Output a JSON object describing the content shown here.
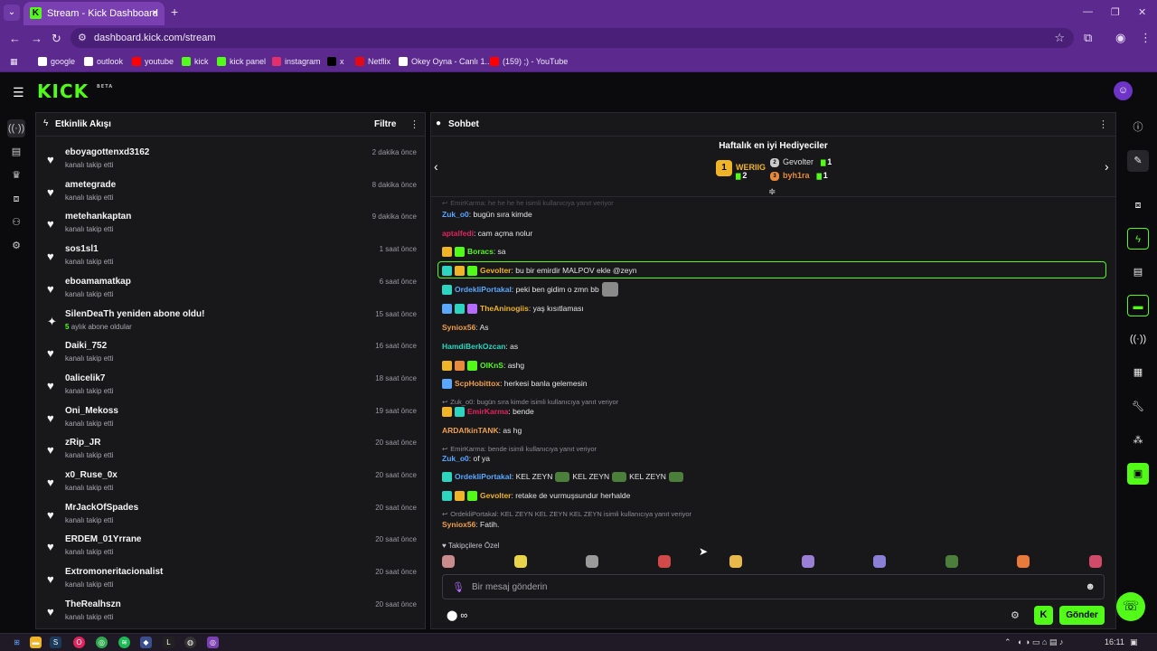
{
  "browser": {
    "tab_title": "Stream - Kick Dashboard",
    "url": "dashboard.kick.com/stream",
    "bookmarks": [
      {
        "label": "google",
        "icon": "google-icon",
        "color": "#ffffff"
      },
      {
        "label": "outlook",
        "icon": "outlook-icon",
        "color": "#ffffff"
      },
      {
        "label": "youtube",
        "icon": "youtube-icon",
        "color": "#ff0000"
      },
      {
        "label": "kick",
        "icon": "kick-icon",
        "color": "#53fc18"
      },
      {
        "label": "kick panel",
        "icon": "kick-icon",
        "color": "#53fc18"
      },
      {
        "label": "instagram",
        "icon": "instagram-icon",
        "color": "#e1306c"
      },
      {
        "label": "x",
        "icon": "x-icon",
        "color": "#000000"
      },
      {
        "label": "Netflix",
        "icon": "netflix-icon",
        "color": "#e50914"
      },
      {
        "label": "Okey Oyna - Canlı 1...",
        "icon": "okey-icon",
        "color": "#ffffff"
      },
      {
        "label": "(159) ;) - YouTube",
        "icon": "youtube-icon",
        "color": "#ff0000"
      }
    ]
  },
  "colors": {
    "accent": "#53fc18",
    "browser_frame": "#5c2a8f",
    "panel": "#18181b"
  },
  "activity": {
    "title": "Etkinlik Akışı",
    "filter_label": "Filtre",
    "items": [
      {
        "name": "eboyagottenxd3162",
        "sub": "kanalı takip etti",
        "time": "2 dakika önce",
        "icon": "heart-icon"
      },
      {
        "name": "ametegrade",
        "sub": "kanalı takip etti",
        "time": "8 dakika önce",
        "icon": "heart-icon"
      },
      {
        "name": "metehankaptan",
        "sub": "kanalı takip etti",
        "time": "9 dakika önce",
        "icon": "heart-icon"
      },
      {
        "name": "sos1sl1",
        "sub": "kanalı takip etti",
        "time": "1 saat önce",
        "icon": "heart-icon"
      },
      {
        "name": "eboamamatkap",
        "sub": "kanalı takip etti",
        "time": "6 saat önce",
        "icon": "heart-icon"
      },
      {
        "name": "SilenDeaTh yeniden abone oldu!",
        "sub_strong": "5",
        "sub": "aylık abone oldular",
        "time": "15 saat önce",
        "icon": "sparkle-icon"
      },
      {
        "name": "Daiki_752",
        "sub": "kanalı takip etti",
        "time": "16 saat önce",
        "icon": "heart-icon"
      },
      {
        "name": "0alicelik7",
        "sub": "kanalı takip etti",
        "time": "18 saat önce",
        "icon": "heart-icon"
      },
      {
        "name": "Oni_Mekoss",
        "sub": "kanalı takip etti",
        "time": "19 saat önce",
        "icon": "heart-icon"
      },
      {
        "name": "zRip_JR",
        "sub": "kanalı takip etti",
        "time": "20 saat önce",
        "icon": "heart-icon"
      },
      {
        "name": "x0_Ruse_0x",
        "sub": "kanalı takip etti",
        "time": "20 saat önce",
        "icon": "heart-icon"
      },
      {
        "name": "MrJackOfSpades",
        "sub": "kanalı takip etti",
        "time": "20 saat önce",
        "icon": "heart-icon"
      },
      {
        "name": "ERDEM_01Yrrane",
        "sub": "kanalı takip etti",
        "time": "20 saat önce",
        "icon": "heart-icon"
      },
      {
        "name": "Extromoneritacionalist",
        "sub": "kanalı takip etti",
        "time": "20 saat önce",
        "icon": "heart-icon"
      },
      {
        "name": "TheRealhszn",
        "sub": "kanalı takip etti",
        "time": "20 saat önce",
        "icon": "heart-icon"
      }
    ]
  },
  "chat": {
    "title": "Sohbet",
    "gifters_title": "Haftalık en iyi Hediyeciler",
    "gifters": [
      {
        "rank": "1",
        "name": "WERIIG",
        "count": "2",
        "color": "#f0b429"
      },
      {
        "rank": "2",
        "name": "Gevolter",
        "count": "1",
        "color": "#c9c9c9"
      },
      {
        "rank": "3",
        "name": "byh1ra",
        "count": "1",
        "color": "#e88a3c"
      }
    ],
    "messages": [
      {
        "type": "reply",
        "text": "EmirKarma: he he he he isimli kullanıcıya yanıt veriyor"
      },
      {
        "user": "Zuk_o0",
        "color": "#5ba7ff",
        "text": ": bugün sıra kimde",
        "badges": []
      },
      {
        "user": "aptalfedi",
        "color": "#e0245e",
        "text": ": cam açma nolur",
        "badges": []
      },
      {
        "user": "Boracs",
        "color": "#53fc18",
        "text": ": sa",
        "badges": [
          "#f0b429",
          "#53fc18"
        ]
      },
      {
        "user": "Gevolter",
        "color": "#f0b429",
        "text": ": bu bir emirdir MALPOV ekle @zeyn",
        "badges": [
          "#2dd4bf",
          "#f0b429",
          "#53fc18"
        ],
        "highlight": true
      },
      {
        "user": "OrdekliPortakal",
        "color": "#5ba7ff",
        "text": ": peki ben gidim o zmn bb",
        "badges": [
          "#2dd4bf"
        ],
        "emote": true
      },
      {
        "user": "TheAninogiis",
        "color": "#f0b429",
        "text": ": yaş kısıtlaması",
        "badges": [
          "#5ba7ff",
          "#2dd4bf",
          "#b46cff"
        ]
      },
      {
        "user": "Syniox56",
        "color": "#f0a04b",
        "text": ": As",
        "badges": []
      },
      {
        "user": "HamdiBerkOzcan",
        "color": "#2dd4bf",
        "text": ": as",
        "badges": []
      },
      {
        "user": "OIKnS",
        "color": "#53fc18",
        "text": ": ashg",
        "badges": [
          "#f0b429",
          "#e88a3c",
          "#53fc18"
        ]
      },
      {
        "user": "ScpHobittox",
        "color": "#f0a04b",
        "text": ": herkesi banla gelemesin",
        "badges": [
          "#5ba7ff"
        ]
      },
      {
        "type": "reply",
        "text": "Zuk_o0: bugün sıra kimde isimli kullanıcıya yanıt veriyor"
      },
      {
        "user": "EmirKarma",
        "color": "#e0245e",
        "text": ": bende",
        "badges": [
          "#f0b429",
          "#2dd4bf"
        ]
      },
      {
        "user": "ARDAfkinTANK",
        "color": "#f0a04b",
        "text": ": as hg",
        "badges": []
      },
      {
        "type": "reply",
        "text": "EmirKarma: bende isimli kullanıcıya yanıt veriyor"
      },
      {
        "user": "Zuk_o0",
        "color": "#5ba7ff",
        "text": ": of ya",
        "badges": []
      },
      {
        "user": "OrdekliPortakal",
        "color": "#5ba7ff",
        "text": ": KEL ZEYN",
        "badges": [
          "#2dd4bf"
        ],
        "kel": true
      },
      {
        "user": "Gevolter",
        "color": "#f0b429",
        "text": ": retake de vurmuşsundur herhalde",
        "badges": [
          "#2dd4bf",
          "#f0b429",
          "#53fc18"
        ]
      },
      {
        "type": "reply",
        "text": "OrdekliPortakal: KEL ZEYN  KEL ZEYN  KEL ZEYN  isimli kullanıcıya yanıt veriyor"
      },
      {
        "user": "Syniox56",
        "color": "#f0a04b",
        "text": ": Fatih.",
        "badges": []
      }
    ],
    "kel_extra": "KEL ZEYN",
    "pinned_label": "Takipçilere Özel",
    "input_placeholder": "Bir mesaj gönderin",
    "points_label": "∞",
    "send_label": "Gönder"
  },
  "taskbar": {
    "time": "16:11"
  }
}
